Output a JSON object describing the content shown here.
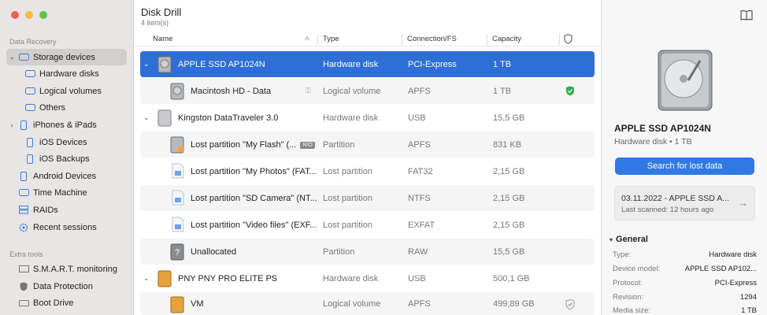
{
  "sidebar": {
    "section_recovery": "Data Recovery",
    "items": [
      {
        "label": "Storage devices",
        "icon": "storage-icon"
      },
      {
        "label": "Hardware disks",
        "icon": "disk-icon"
      },
      {
        "label": "Logical volumes",
        "icon": "disk-icon"
      },
      {
        "label": "Others",
        "icon": "disk-icon"
      },
      {
        "label": "iPhones & iPads",
        "icon": "phone-icon"
      },
      {
        "label": "iOS Devices",
        "icon": "phone-icon"
      },
      {
        "label": "iOS Backups",
        "icon": "phone-icon"
      },
      {
        "label": "Android Devices",
        "icon": "phone-icon"
      },
      {
        "label": "Time Machine",
        "icon": "clock-icon"
      },
      {
        "label": "RAIDs",
        "icon": "raid-icon"
      },
      {
        "label": "Recent sessions",
        "icon": "gear-icon"
      }
    ],
    "section_extra": "Extra tools",
    "extra_items": [
      {
        "label": "S.M.A.R.T. monitoring",
        "icon": "monitor-icon"
      },
      {
        "label": "Data Protection",
        "icon": "shield-icon"
      },
      {
        "label": "Boot Drive",
        "icon": "drive-icon"
      }
    ]
  },
  "main": {
    "title": "Disk Drill",
    "subtitle": "4 item(s)",
    "columns": {
      "name": "Name",
      "type": "Type",
      "conn": "Connection/FS",
      "capacity": "Capacity"
    },
    "rows": [
      {
        "name": "APPLE SSD AP1024N",
        "type": "Hardware disk",
        "conn": "PCI-Express",
        "capacity": "1 TB"
      },
      {
        "name": "Macintosh HD - Data",
        "type": "Logical volume",
        "conn": "APFS",
        "capacity": "1 TB"
      },
      {
        "name": "Kingston DataTraveler 3.0",
        "type": "Hardware disk",
        "conn": "USB",
        "capacity": "15,5 GB"
      },
      {
        "name": "Lost partition \"My Flash\" (...",
        "badge": "R/O",
        "type": "Partition",
        "conn": "APFS",
        "capacity": "831 KB"
      },
      {
        "name": "Lost partition \"My Photos\" (FAT...",
        "type": "Lost partition",
        "conn": "FAT32",
        "capacity": "2,15 GB"
      },
      {
        "name": "Lost partition \"SD Camera\" (NT...",
        "type": "Lost partition",
        "conn": "NTFS",
        "capacity": "2,15 GB"
      },
      {
        "name": "Lost partition \"Video files\" (EXF...",
        "type": "Lost partition",
        "conn": "EXFAT",
        "capacity": "2,15 GB"
      },
      {
        "name": "Unallocated",
        "type": "Partition",
        "conn": "RAW",
        "capacity": "15,5 GB"
      },
      {
        "name": "PNY PNY PRO ELITE PS",
        "type": "Hardware disk",
        "conn": "USB",
        "capacity": "500,1 GB"
      },
      {
        "name": "VM",
        "type": "Logical volume",
        "conn": "APFS",
        "capacity": "499,89 GB"
      }
    ]
  },
  "panel": {
    "device_name": "APPLE SSD AP1024N",
    "device_type": "Hardware disk • 1 TB",
    "search_label": "Search for lost data",
    "session_title": "03.11.2022 - APPLE SSD A...",
    "session_sub": "Last scanned: 12 hours ago",
    "general_label": "General",
    "props": [
      {
        "k": "Type:",
        "v": "Hardware disk"
      },
      {
        "k": "Device model:",
        "v": "APPLE SSD AP102..."
      },
      {
        "k": "Protocol:",
        "v": "PCI-Express"
      },
      {
        "k": "Revision:",
        "v": "1294"
      },
      {
        "k": "Media size:",
        "v": "1 TB"
      }
    ]
  },
  "colors": {
    "accent": "#2d6fd6",
    "button": "#2f7ae5",
    "ok_green": "#35a852"
  }
}
